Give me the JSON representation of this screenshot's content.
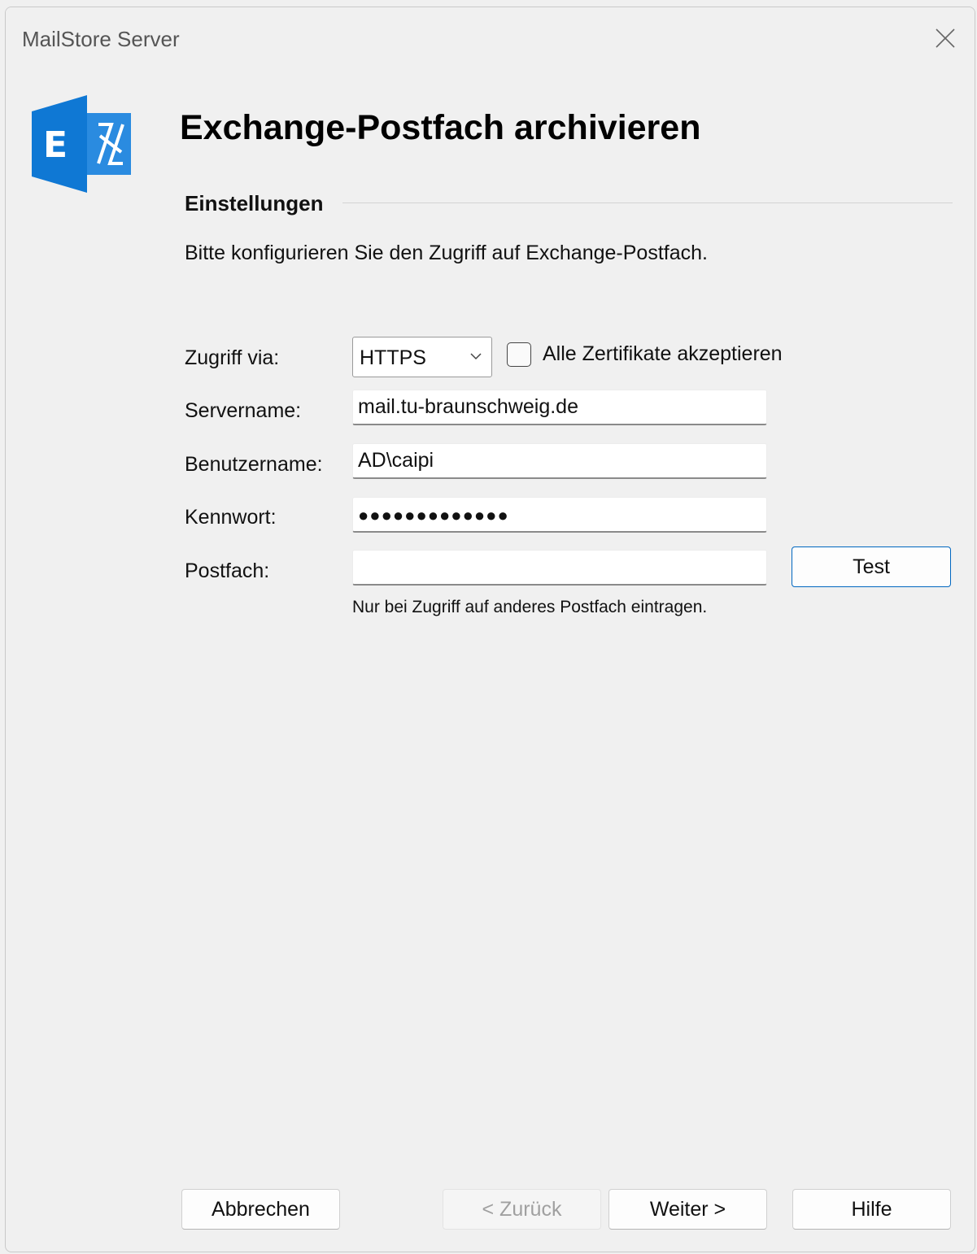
{
  "window": {
    "title": "MailStore Server"
  },
  "header": {
    "heading": "Exchange-Postfach archivieren"
  },
  "section": {
    "title": "Einstellungen",
    "description": "Bitte konfigurieren Sie den Zugriff auf Exchange-Postfach."
  },
  "form": {
    "access": {
      "label": "Zugriff via:",
      "value": "HTTPS"
    },
    "accept_all_certs": {
      "label": "Alle Zertifikate akzeptieren",
      "checked": false
    },
    "server": {
      "label": "Servername:",
      "value": "mail.tu-braunschweig.de"
    },
    "user": {
      "label": "Benutzername:",
      "value": "AD\\caipi"
    },
    "password": {
      "label": "Kennwort:",
      "value": "●●●●●●●●●●●●●"
    },
    "mailbox": {
      "label": "Postfach:",
      "value": "",
      "hint": "Nur bei Zugriff auf anderes Postfach eintragen."
    },
    "test_label": "Test"
  },
  "footer": {
    "cancel": "Abbrechen",
    "back": "< Zurück",
    "next": "Weiter >",
    "help": "Hilfe"
  },
  "colors": {
    "accent": "#0067c0",
    "exchange_blue": "#0f78d4"
  },
  "icons": {
    "app": "exchange-icon",
    "close": "close-icon",
    "dropdown": "chevron-down-icon"
  }
}
